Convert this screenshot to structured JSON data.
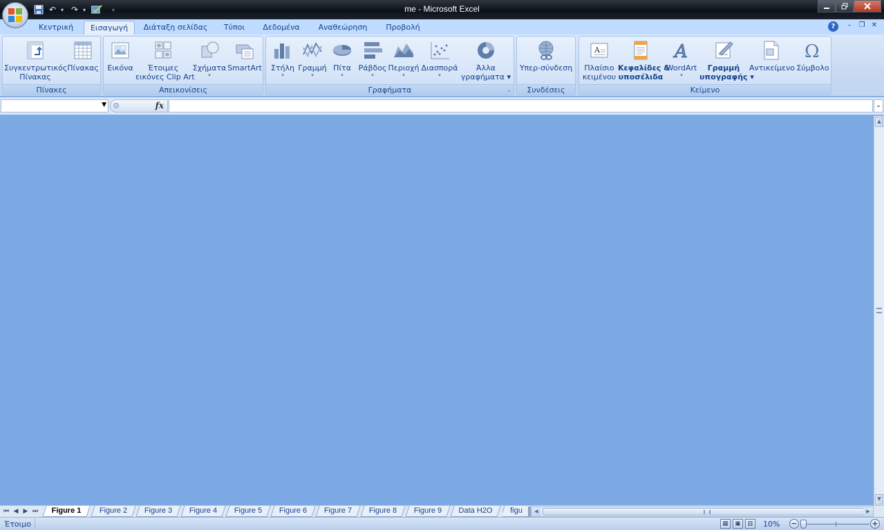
{
  "window": {
    "title": "me - Microsoft Excel",
    "controls": [
      "minimize",
      "restore",
      "close"
    ]
  },
  "quick_access": {
    "items": [
      "save-icon",
      "undo-icon",
      "redo-icon",
      "check-icon",
      "customize-icon"
    ]
  },
  "tabs": [
    {
      "label": "Κεντρική"
    },
    {
      "label": "Εισαγωγή"
    },
    {
      "label": "Διάταξη σελίδας"
    },
    {
      "label": "Τύποι"
    },
    {
      "label": "Δεδομένα"
    },
    {
      "label": "Αναθεώρηση"
    },
    {
      "label": "Προβολή"
    }
  ],
  "active_tab": "Εισαγωγή",
  "ribbon": {
    "groups": {
      "tables": {
        "label": "Πίνακες",
        "pivot_line1": "Συγκεντρωτικός",
        "pivot_line2": "Πίνακας",
        "table": "Πίνακας"
      },
      "illustrations": {
        "label": "Απεικονίσεις",
        "picture": "Εικόνα",
        "clipart_line1": "Έτοιμες",
        "clipart_line2": "εικόνες Clip Art",
        "shapes": "Σχήματα",
        "smartart": "SmartArt"
      },
      "charts": {
        "label": "Γραφήματα",
        "column": "Στήλη",
        "line": "Γραμμή",
        "pie": "Πίτα",
        "bar": "Ράβδος",
        "area": "Περιοχή",
        "scatter": "Διασπορά",
        "other_line1": "Άλλα",
        "other_line2": "γραφήματα"
      },
      "links": {
        "label": "Συνδέσεις",
        "hyperlink": "Υπερ-σύνδεση"
      },
      "text": {
        "label": "Κείμενο",
        "textbox_line1": "Πλαίσιο",
        "textbox_line2": "κειμένου",
        "header_line1": "Κεφαλίδες &",
        "header_line2": "υποσέλιδα",
        "wordart": "WordArt",
        "signature_line1": "Γραμμή",
        "signature_line2": "υπογραφής",
        "object": "Αντικείμενο",
        "symbol": "Σύμβολο"
      }
    }
  },
  "formula_bar": {
    "name_box_value": "",
    "fx_label": "fx",
    "formula_value": ""
  },
  "sheet_tabs": [
    {
      "label": "Figure 1"
    },
    {
      "label": "Figure 2"
    },
    {
      "label": "Figure 3"
    },
    {
      "label": "Figure 4"
    },
    {
      "label": "Figure 5"
    },
    {
      "label": "Figure 6"
    },
    {
      "label": "Figure 7"
    },
    {
      "label": "Figure 8"
    },
    {
      "label": "Figure 9"
    },
    {
      "label": "Data H2O"
    },
    {
      "label": "figu"
    }
  ],
  "active_sheet": "Figure 1",
  "status": {
    "ready": "Έτοιμο",
    "zoom": "10%"
  },
  "colors": {
    "workspace": "#7da9e4",
    "ribbon_text": "#15428b",
    "title_bar": "#0d1218"
  }
}
